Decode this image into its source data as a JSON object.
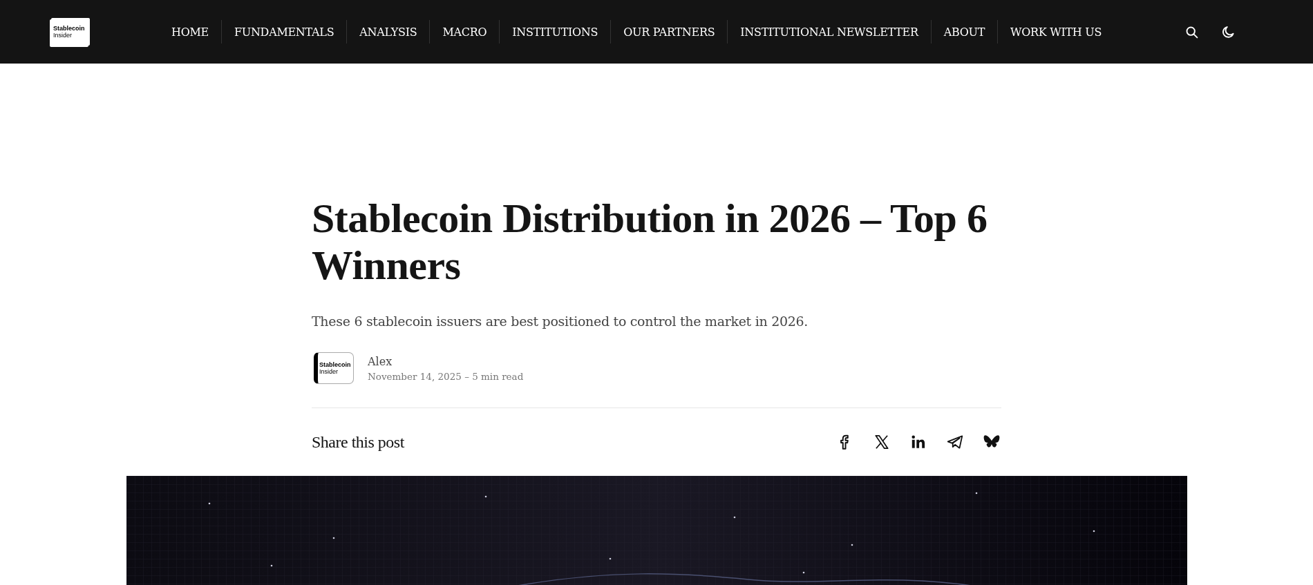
{
  "header": {
    "logo": {
      "line_1": "Stablecoin",
      "line_2": "Insider"
    },
    "nav": [
      {
        "label": "HOME"
      },
      {
        "label": "FUNDAMENTALS"
      },
      {
        "label": "ANALYSIS"
      },
      {
        "label": "MACRO"
      },
      {
        "label": "INSTITUTIONS"
      },
      {
        "label": "OUR PARTNERS"
      },
      {
        "label": "INSTITUTIONAL NEWSLETTER"
      },
      {
        "label": "ABOUT"
      },
      {
        "label": "WORK WITH US"
      }
    ]
  },
  "article": {
    "title": "Stablecoin Distribution in 2026 – Top 6 Winners",
    "subtitle": "These 6 stablecoin issuers are best positioned to control the market in 2026.",
    "author": {
      "name": "Alex",
      "avatar": {
        "line_1": "Stablecoin",
        "line_2": "Insider"
      }
    },
    "meta": "November 14, 2025 – 5 min read",
    "share": {
      "label": "Share this post",
      "buttons": [
        {
          "kind": "facebook"
        },
        {
          "kind": "x"
        },
        {
          "kind": "linkedin"
        },
        {
          "kind": "telegram"
        },
        {
          "kind": "bluesky"
        }
      ]
    }
  }
}
